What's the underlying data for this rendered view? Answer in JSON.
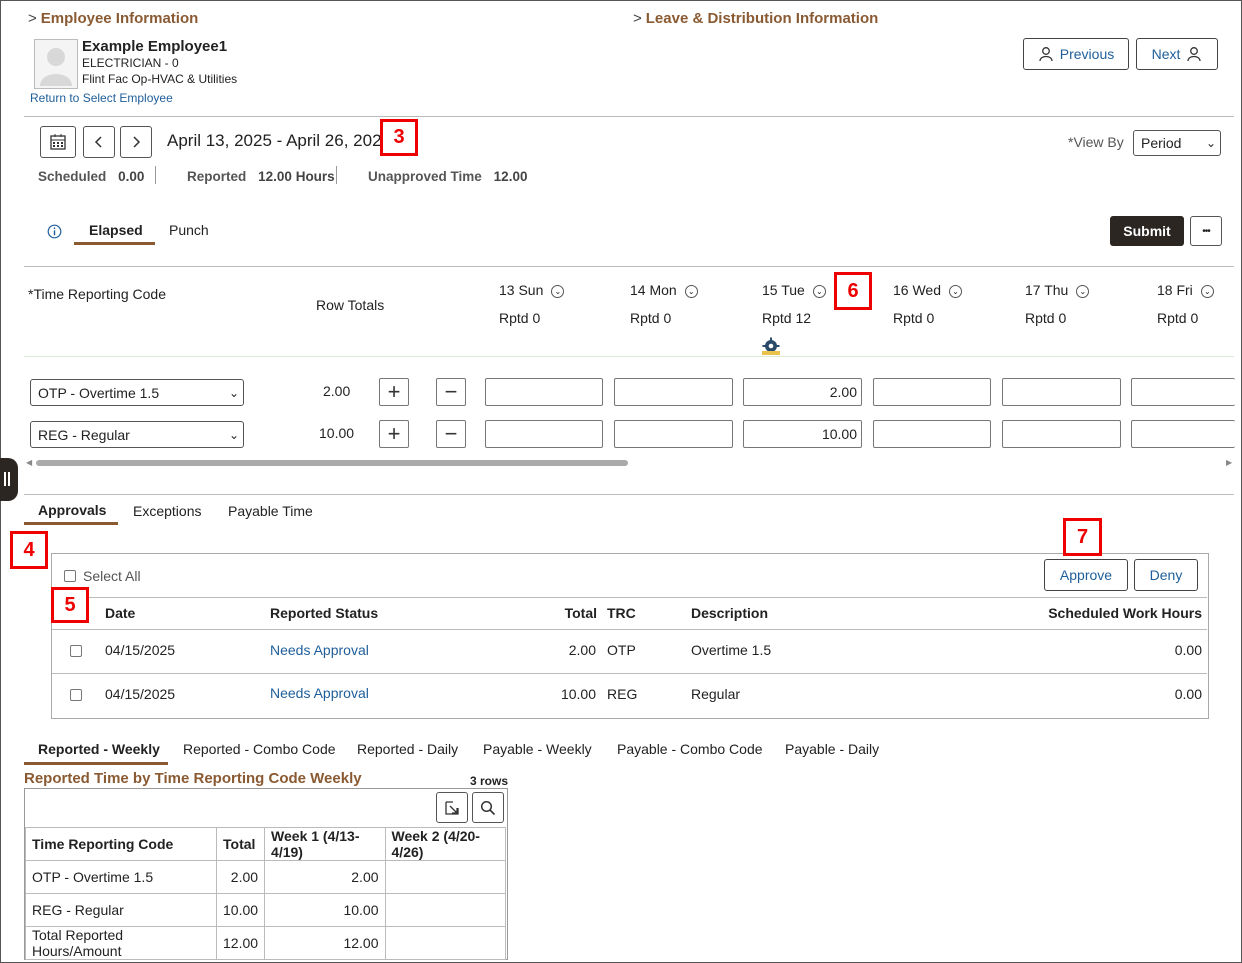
{
  "sections": {
    "employee_info": "Employee Information",
    "leave_info": "Leave & Distribution Information"
  },
  "employee": {
    "name": "Example Employee1",
    "title": "ELECTRICIAN - 0",
    "department": "Flint Fac Op-HVAC & Utilities",
    "return_link": "Return to Select Employee"
  },
  "nav": {
    "previous": "Previous",
    "next": "Next"
  },
  "period": {
    "range": "April 13, 2025 - April 26, 2025",
    "view_by_label": "*View By",
    "view_by_value": "Period"
  },
  "summary": [
    {
      "label": "Scheduled",
      "value": "0.00"
    },
    {
      "label": "Reported",
      "value": "12.00 Hours"
    },
    {
      "label": "Unapproved Time",
      "value": "12.00"
    }
  ],
  "mode_tabs": {
    "elapsed": "Elapsed",
    "punch": "Punch"
  },
  "actions": {
    "submit": "Submit",
    "more": "•••"
  },
  "grid": {
    "trc_header": "*Time Reporting Code",
    "row_totals_header": "Row Totals",
    "days": [
      {
        "label": "13 Sun",
        "rptd": "Rptd 0"
      },
      {
        "label": "14 Mon",
        "rptd": "Rptd 0"
      },
      {
        "label": "15 Tue",
        "rptd": "Rptd 12"
      },
      {
        "label": "16 Wed",
        "rptd": "Rptd 0"
      },
      {
        "label": "17 Thu",
        "rptd": "Rptd 0"
      },
      {
        "label": "18 Fri",
        "rptd": "Rptd 0"
      }
    ],
    "rows": [
      {
        "trc": "OTP - Overtime 1.5",
        "total": "2.00",
        "values": [
          "",
          "",
          "2.00",
          "",
          "",
          ""
        ]
      },
      {
        "trc": "REG - Regular",
        "total": "10.00",
        "values": [
          "",
          "",
          "10.00",
          "",
          "",
          ""
        ]
      }
    ]
  },
  "lower_tabs": {
    "approvals": "Approvals",
    "exceptions": "Exceptions",
    "payable": "Payable Time"
  },
  "approvals": {
    "select_all": "Select All",
    "approve": "Approve",
    "deny": "Deny",
    "columns": {
      "date": "Date",
      "status": "Reported Status",
      "total": "Total",
      "trc": "TRC",
      "description": "Description",
      "sched": "Scheduled Work Hours"
    },
    "rows": [
      {
        "date": "04/15/2025",
        "status": "Needs Approval",
        "total": "2.00",
        "trc": "OTP",
        "description": "Overtime 1.5",
        "sched": "0.00"
      },
      {
        "date": "04/15/2025",
        "status": "Needs Approval",
        "total": "10.00",
        "trc": "REG",
        "description": "Regular",
        "sched": "0.00"
      }
    ]
  },
  "report_tabs": [
    "Reported - Weekly",
    "Reported - Combo Code",
    "Reported - Daily",
    "Payable - Weekly",
    "Payable - Combo Code",
    "Payable - Daily"
  ],
  "weekly": {
    "title": "Reported Time by Time Reporting Code Weekly",
    "rows_count": "3 rows",
    "columns": [
      "Time Reporting Code",
      "Total",
      "Week 1 (4/13-4/19)",
      "Week 2 (4/20-4/26)"
    ],
    "rows": [
      [
        "OTP - Overtime 1.5",
        "2.00",
        "2.00",
        ""
      ],
      [
        "REG - Regular",
        "10.00",
        "10.00",
        ""
      ],
      [
        "Total Reported Hours/Amount",
        "12.00",
        "12.00",
        ""
      ]
    ]
  },
  "callouts": {
    "c3": "3",
    "c4": "4",
    "c5": "5",
    "c6": "6",
    "c7": "7"
  },
  "colors": {
    "accent": "#8a5a32",
    "link": "#1f5e9a",
    "callout": "#e00000",
    "submit_bg": "#2b2622"
  },
  "icons": [
    "calendar-icon",
    "chevron-left-icon",
    "chevron-right-icon",
    "user-icon",
    "info-icon",
    "add-icon",
    "remove-icon",
    "chevron-down-icon",
    "export-icon",
    "search-icon",
    "gear-icon"
  ]
}
